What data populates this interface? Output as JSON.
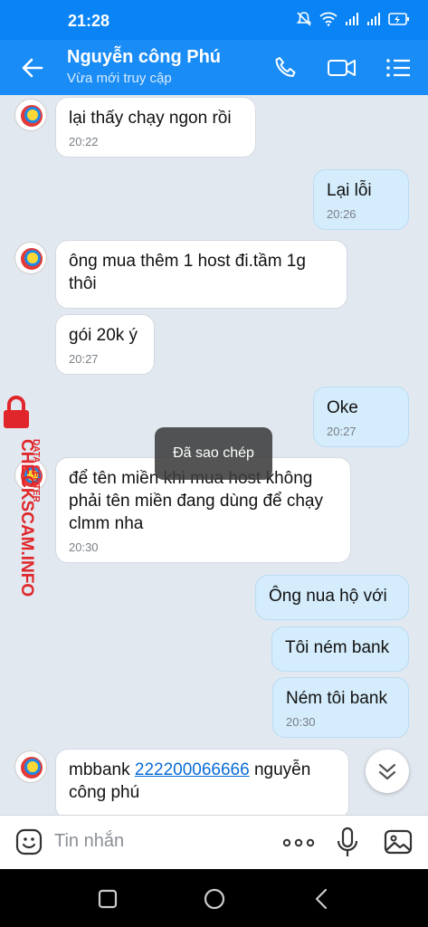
{
  "status_bar": {
    "time": "21:28"
  },
  "header": {
    "contact_name": "Nguyễn công Phú",
    "contact_status": "Vừa mới truy cập"
  },
  "messages": [
    {
      "side": "in",
      "text": "lại thấy chạy ngon rồi",
      "time": "20:22"
    },
    {
      "side": "out",
      "text": "Lại lỗi",
      "time": "20:26"
    },
    {
      "side": "in",
      "text": "ông mua thêm 1 host đi.tầm 1g thôi",
      "time": ""
    },
    {
      "side": "in",
      "text": "gói 20k ý",
      "time": "20:27"
    },
    {
      "side": "out",
      "text": "Oke",
      "time": "20:27"
    },
    {
      "side": "in",
      "text": "để tên miền khi mua host không phải tên miền đang dùng để chạy clmm nha",
      "time": "20:30"
    },
    {
      "side": "out",
      "text": "Ông nua hộ với",
      "time": ""
    },
    {
      "side": "out",
      "text": "Tôi ném bank",
      "time": ""
    },
    {
      "side": "out",
      "text": "Ném tôi bank",
      "time": "20:30"
    },
    {
      "side": "in",
      "text_before": "mbbank ",
      "link": "222200066666",
      "text_after": " nguyễn công phú",
      "time": ""
    }
  ],
  "toast": "Đã sao chép",
  "watermark": {
    "main": "CHECKSCAM.INFO",
    "sub": "DATA CENTER",
    "color": "#e0262a"
  },
  "composer": {
    "placeholder": "Tin nhắn"
  },
  "colors": {
    "header": "#1a8cf5",
    "outgoing_bubble": "#d4ecfb",
    "incoming_bubble": "#ffffff",
    "background": "#e2e8f0"
  }
}
